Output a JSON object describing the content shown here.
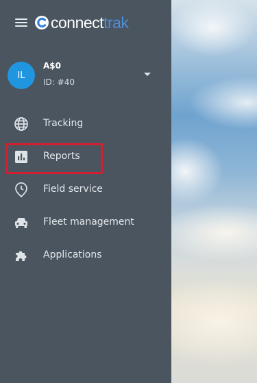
{
  "brand": {
    "name_part1": "connect",
    "name_part2": "trak",
    "logo_icon": "connecttrak-logo-icon",
    "accent_color": "#4f8fd6"
  },
  "header": {
    "menu_icon": "hamburger-menu-icon"
  },
  "user": {
    "initials": "IL",
    "name": "A$0",
    "id_text": "ID: #40",
    "avatar_color": "#2196e0",
    "dropdown_icon": "caret-down-icon"
  },
  "nav": {
    "items": [
      {
        "label": "Tracking",
        "icon": "globe-icon"
      },
      {
        "label": "Reports",
        "icon": "bar-chart-icon",
        "highlighted": true
      },
      {
        "label": "Field service",
        "icon": "location-clock-icon"
      },
      {
        "label": "Fleet management",
        "icon": "car-icon"
      },
      {
        "label": "Applications",
        "icon": "puzzle-icon"
      }
    ]
  },
  "colors": {
    "sidebar_bg": "#4a5560",
    "highlight_border": "#d32030"
  }
}
